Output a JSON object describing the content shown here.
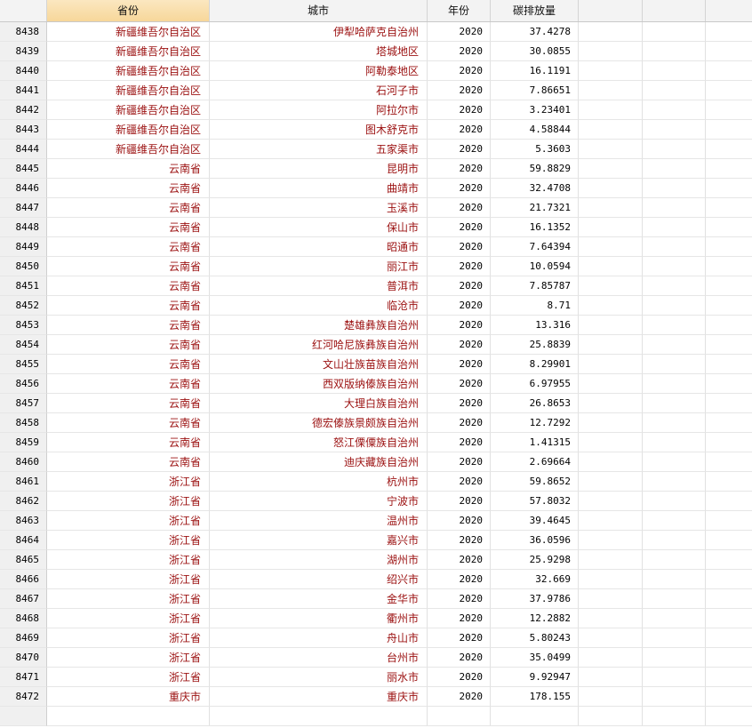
{
  "columns": [
    "",
    "省份",
    "城市",
    "年份",
    "碳排放量",
    "",
    "",
    ""
  ],
  "rows": [
    {
      "id": "8438",
      "province": "新疆维吾尔自治区",
      "city": "伊犁哈萨克自治州",
      "year": "2020",
      "emission": "37.4278"
    },
    {
      "id": "8439",
      "province": "新疆维吾尔自治区",
      "city": "塔城地区",
      "year": "2020",
      "emission": "30.0855"
    },
    {
      "id": "8440",
      "province": "新疆维吾尔自治区",
      "city": "阿勒泰地区",
      "year": "2020",
      "emission": "16.1191"
    },
    {
      "id": "8441",
      "province": "新疆维吾尔自治区",
      "city": "石河子市",
      "year": "2020",
      "emission": "7.86651"
    },
    {
      "id": "8442",
      "province": "新疆维吾尔自治区",
      "city": "阿拉尔市",
      "year": "2020",
      "emission": "3.23401"
    },
    {
      "id": "8443",
      "province": "新疆维吾尔自治区",
      "city": "图木舒克市",
      "year": "2020",
      "emission": "4.58844"
    },
    {
      "id": "8444",
      "province": "新疆维吾尔自治区",
      "city": "五家渠市",
      "year": "2020",
      "emission": "5.3603"
    },
    {
      "id": "8445",
      "province": "云南省",
      "city": "昆明市",
      "year": "2020",
      "emission": "59.8829"
    },
    {
      "id": "8446",
      "province": "云南省",
      "city": "曲靖市",
      "year": "2020",
      "emission": "32.4708"
    },
    {
      "id": "8447",
      "province": "云南省",
      "city": "玉溪市",
      "year": "2020",
      "emission": "21.7321"
    },
    {
      "id": "8448",
      "province": "云南省",
      "city": "保山市",
      "year": "2020",
      "emission": "16.1352"
    },
    {
      "id": "8449",
      "province": "云南省",
      "city": "昭通市",
      "year": "2020",
      "emission": "7.64394"
    },
    {
      "id": "8450",
      "province": "云南省",
      "city": "丽江市",
      "year": "2020",
      "emission": "10.0594"
    },
    {
      "id": "8451",
      "province": "云南省",
      "city": "普洱市",
      "year": "2020",
      "emission": "7.85787"
    },
    {
      "id": "8452",
      "province": "云南省",
      "city": "临沧市",
      "year": "2020",
      "emission": "8.71"
    },
    {
      "id": "8453",
      "province": "云南省",
      "city": "楚雄彝族自治州",
      "year": "2020",
      "emission": "13.316"
    },
    {
      "id": "8454",
      "province": "云南省",
      "city": "红河哈尼族彝族自治州",
      "year": "2020",
      "emission": "25.8839"
    },
    {
      "id": "8455",
      "province": "云南省",
      "city": "文山壮族苗族自治州",
      "year": "2020",
      "emission": "8.29901"
    },
    {
      "id": "8456",
      "province": "云南省",
      "city": "西双版纳傣族自治州",
      "year": "2020",
      "emission": "6.97955"
    },
    {
      "id": "8457",
      "province": "云南省",
      "city": "大理白族自治州",
      "year": "2020",
      "emission": "26.8653"
    },
    {
      "id": "8458",
      "province": "云南省",
      "city": "德宏傣族景颇族自治州",
      "year": "2020",
      "emission": "12.7292"
    },
    {
      "id": "8459",
      "province": "云南省",
      "city": "怒江傈僳族自治州",
      "year": "2020",
      "emission": "1.41315"
    },
    {
      "id": "8460",
      "province": "云南省",
      "city": "迪庆藏族自治州",
      "year": "2020",
      "emission": "2.69664"
    },
    {
      "id": "8461",
      "province": "浙江省",
      "city": "杭州市",
      "year": "2020",
      "emission": "59.8652"
    },
    {
      "id": "8462",
      "province": "浙江省",
      "city": "宁波市",
      "year": "2020",
      "emission": "57.8032"
    },
    {
      "id": "8463",
      "province": "浙江省",
      "city": "温州市",
      "year": "2020",
      "emission": "39.4645"
    },
    {
      "id": "8464",
      "province": "浙江省",
      "city": "嘉兴市",
      "year": "2020",
      "emission": "36.0596"
    },
    {
      "id": "8465",
      "province": "浙江省",
      "city": "湖州市",
      "year": "2020",
      "emission": "25.9298"
    },
    {
      "id": "8466",
      "province": "浙江省",
      "city": "绍兴市",
      "year": "2020",
      "emission": "32.669"
    },
    {
      "id": "8467",
      "province": "浙江省",
      "city": "金华市",
      "year": "2020",
      "emission": "37.9786"
    },
    {
      "id": "8468",
      "province": "浙江省",
      "city": "衢州市",
      "year": "2020",
      "emission": "12.2882"
    },
    {
      "id": "8469",
      "province": "浙江省",
      "city": "舟山市",
      "year": "2020",
      "emission": "5.80243"
    },
    {
      "id": "8470",
      "province": "浙江省",
      "city": "台州市",
      "year": "2020",
      "emission": "35.0499"
    },
    {
      "id": "8471",
      "province": "浙江省",
      "city": "丽水市",
      "year": "2020",
      "emission": "9.92947"
    },
    {
      "id": "8472",
      "province": "重庆市",
      "city": "重庆市",
      "year": "2020",
      "emission": "178.155"
    }
  ]
}
